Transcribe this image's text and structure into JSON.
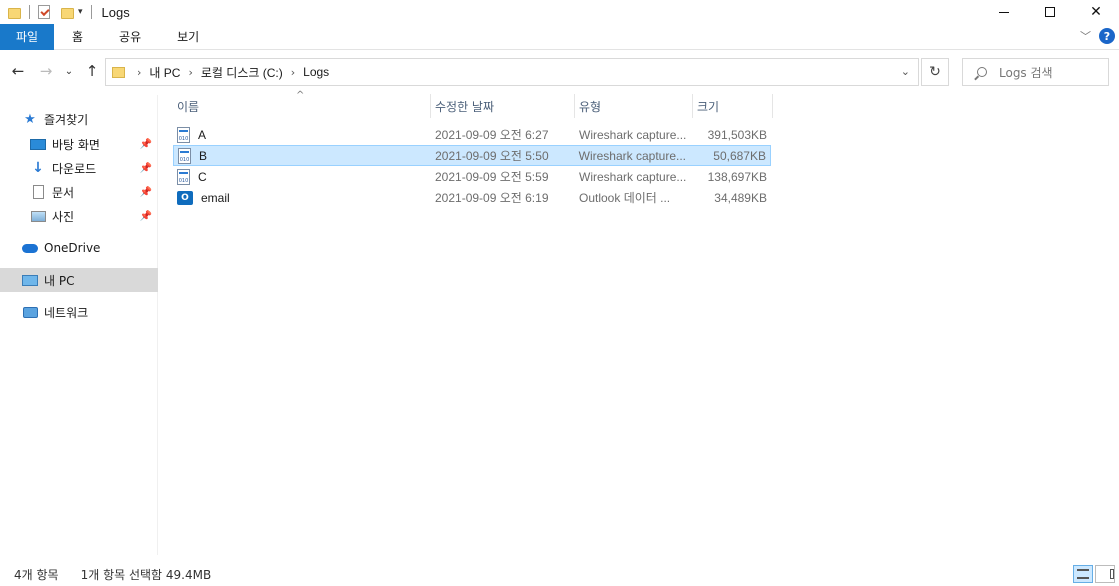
{
  "window": {
    "title": "Logs",
    "minimize_icon": "minimize-icon",
    "maximize_icon": "maximize-icon",
    "close_glyph": "✕"
  },
  "ribbon": {
    "tabs": [
      "파일",
      "홈",
      "공유",
      "보기"
    ],
    "help_glyph": "?"
  },
  "address": {
    "crumbs": [
      "내 PC",
      "로컬 디스크 (C:)",
      "Logs"
    ],
    "search_placeholder": "Logs 검색"
  },
  "nav": {
    "quick_access": "즐겨찾기",
    "items": [
      {
        "label": "바탕 화면",
        "icon": "desktop-icon",
        "pinned": true
      },
      {
        "label": "다운로드",
        "icon": "download-icon",
        "pinned": true
      },
      {
        "label": "문서",
        "icon": "document-icon",
        "pinned": true
      },
      {
        "label": "사진",
        "icon": "pictures-icon",
        "pinned": true
      }
    ],
    "onedrive": "OneDrive",
    "this_pc": "내 PC",
    "network": "네트워크"
  },
  "columns": {
    "name": "이름",
    "date": "수정한 날짜",
    "type": "유형",
    "size": "크기"
  },
  "files": [
    {
      "name": "A",
      "date": "2021-09-09 오전 6:27",
      "type": "Wireshark capture...",
      "size": "391,503KB",
      "icon": "capture-file-icon",
      "selected": false
    },
    {
      "name": "B",
      "date": "2021-09-09 오전 5:50",
      "type": "Wireshark capture...",
      "size": "50,687KB",
      "icon": "capture-file-icon",
      "selected": true
    },
    {
      "name": "C",
      "date": "2021-09-09 오전 5:59",
      "type": "Wireshark capture...",
      "size": "138,697KB",
      "icon": "capture-file-icon",
      "selected": false
    },
    {
      "name": "email",
      "date": "2021-09-09 오전 6:19",
      "type": "Outlook 데이터 ...",
      "size": "34,489KB",
      "icon": "outlook-file-icon",
      "selected": false
    }
  ],
  "status": {
    "count": "4개 항목",
    "selection": "1개 항목 선택함 49.4MB"
  },
  "colors": {
    "file_tab": "#1979ca",
    "selection_bg": "#cce8ff",
    "selection_border": "#99d1ff",
    "nav_selected": "#d9d9d9"
  }
}
